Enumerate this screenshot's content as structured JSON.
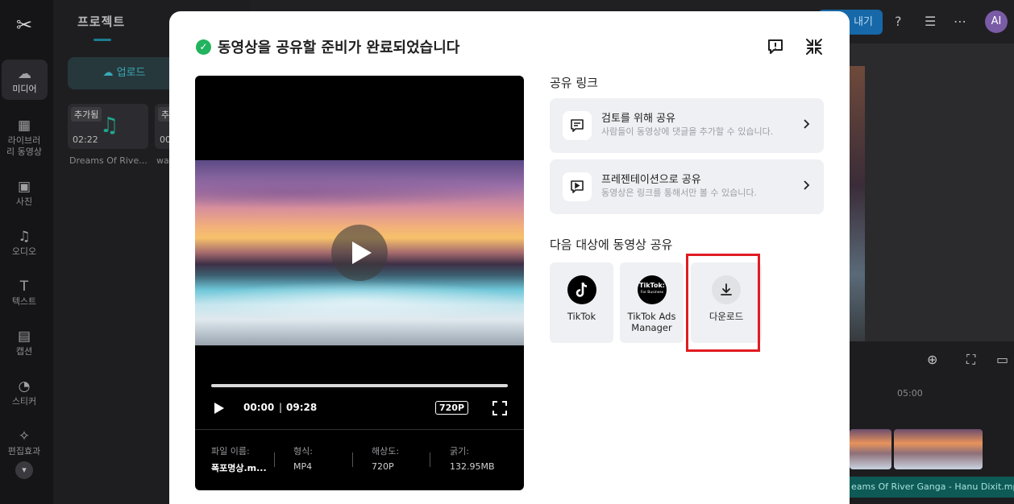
{
  "background": {
    "rail_items": [
      {
        "label": "미디어",
        "icon": "cloud-icon"
      },
      {
        "label": "라이브러리 동영상",
        "icon": "film-icon"
      },
      {
        "label": "사진",
        "icon": "image-icon"
      },
      {
        "label": "오디오",
        "icon": "music-icon"
      },
      {
        "label": "텍스트",
        "icon": "text-icon"
      },
      {
        "label": "캡션",
        "icon": "caption-icon"
      },
      {
        "label": "스티커",
        "icon": "sticker-icon"
      },
      {
        "label": "편집효과",
        "icon": "effects-icon"
      }
    ],
    "panel_title": "프로젝트",
    "upload_label": "업로드",
    "media": [
      {
        "tag": "추가됨",
        "duration": "02:22",
        "name": "Dreams Of Rive..."
      },
      {
        "tag": "추",
        "duration": "00",
        "name": "wa"
      }
    ],
    "export_label": "내기",
    "avatar_initials": "AI",
    "timeline_time": "05:00",
    "audio_track": "eams Of River Ganga - Hanu Dixit.mp"
  },
  "modal": {
    "title": "동영상을 공유할 준비가 완료되었습니다",
    "player": {
      "current_time": "00:00",
      "separator": "|",
      "total_time": "09:28",
      "resolution_badge": "720P",
      "progress": 0,
      "info": [
        {
          "label": "파일 이름:",
          "value": "폭포명상.m..."
        },
        {
          "label": "형식:",
          "value": "MP4"
        },
        {
          "label": "해상도:",
          "value": "720P"
        },
        {
          "label": "굵기:",
          "value": "132.95MB"
        }
      ]
    },
    "share_link_title": "공유 링크",
    "share_options": [
      {
        "title": "검토를 위해 공유",
        "subtitle": "사람들이 동영상에 댓글을 추가할 수 있습니다.",
        "icon": "comment-icon"
      },
      {
        "title": "프레젠테이션으로 공유",
        "subtitle": "동영상은 링크를 통해서만 볼 수 있습니다.",
        "icon": "presentation-icon"
      }
    ],
    "share_to_title": "다음 대상에 동영상 공유",
    "targets": [
      {
        "label": "TikTok",
        "icon": "tiktok-icon"
      },
      {
        "label": "TikTok Ads Manager",
        "icon": "tiktok-business-icon",
        "logo_text": "TikTok:",
        "logo_sub": "For Business"
      },
      {
        "label": "다운로드",
        "icon": "download-icon"
      }
    ]
  },
  "colors": {
    "accent_teal": "#1b7d8f",
    "success_green": "#22b35e",
    "highlight_red": "#e11b22"
  }
}
